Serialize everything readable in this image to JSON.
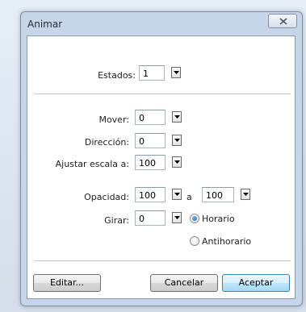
{
  "window": {
    "title": "Animar"
  },
  "states": {
    "label": "Estados:",
    "value": "1"
  },
  "move": {
    "label": "Mover:",
    "value": "0"
  },
  "direction": {
    "label": "Dirección:",
    "value": "0"
  },
  "scale": {
    "label": "Ajustar escala a:",
    "value": "100"
  },
  "opacity": {
    "label": "Opacidad:",
    "from_value": "100",
    "connector": "a",
    "to_value": "100"
  },
  "rotate": {
    "label": "Girar:",
    "value": "0",
    "options": [
      "Horario",
      "Antihorario"
    ],
    "selected": "Horario"
  },
  "buttons": {
    "edit": "Editar...",
    "cancel": "Cancelar",
    "accept": "Aceptar"
  },
  "colors": {
    "frame": "#c6d6e8",
    "client": "#ffffff",
    "default_button": "#bee6fd",
    "radio_selected": "#1d5fb0"
  },
  "icons": {
    "close": "close-icon",
    "dropdown": "chevron-down-icon"
  }
}
